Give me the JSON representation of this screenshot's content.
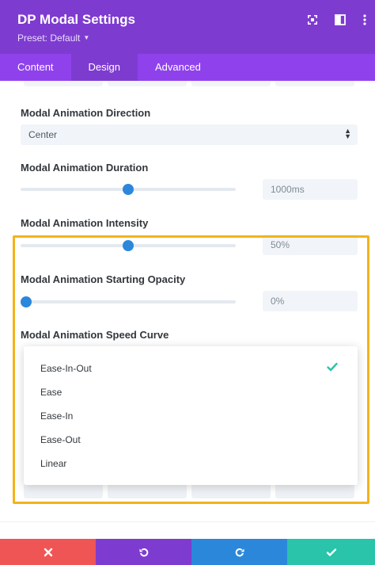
{
  "header": {
    "title": "DP Modal Settings",
    "preset": "Preset: Default",
    "icons": [
      "expand-icon",
      "sidebar-icon",
      "more-icon"
    ]
  },
  "tabs": [
    {
      "label": "Content",
      "active": false
    },
    {
      "label": "Design",
      "active": true
    },
    {
      "label": "Advanced",
      "active": false
    }
  ],
  "fields": {
    "direction": {
      "label": "Modal Animation Direction",
      "value": "Center"
    },
    "duration": {
      "label": "Modal Animation Duration",
      "value": "1000ms",
      "slider_percent": 50
    },
    "intensity": {
      "label": "Modal Animation Intensity",
      "value": "50%",
      "slider_percent": 50
    },
    "opacity": {
      "label": "Modal Animation Starting Opacity",
      "value": "0%",
      "slider_percent": 0
    },
    "speed_curve": {
      "label": "Modal Animation Speed Curve",
      "options": [
        "Ease-In-Out",
        "Ease",
        "Ease-In",
        "Ease-Out",
        "Linear"
      ],
      "selected": "Ease-In-Out"
    }
  },
  "footer": {
    "buttons": [
      "cancel",
      "undo",
      "redo",
      "save"
    ]
  },
  "colors": {
    "header_purple": "#7e3bd0",
    "tab_purple": "#8f42ec",
    "slider_blue": "#2b87da",
    "highlight_yellow": "#f3b31a",
    "check_green": "#29c4a9",
    "cancel_red": "#ef5555",
    "redo_blue": "#2b87da",
    "save_green": "#29c4a9"
  }
}
